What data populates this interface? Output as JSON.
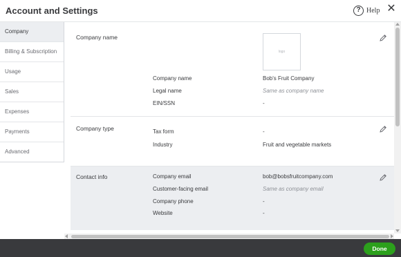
{
  "header": {
    "title": "Account and Settings",
    "help_label": "Help",
    "help_icon_glyph": "?",
    "close_glyph": "✕"
  },
  "sidebar": {
    "items": [
      {
        "label": "Company",
        "active": true
      },
      {
        "label": "Billing & Subscription"
      },
      {
        "label": "Usage"
      },
      {
        "label": "Sales"
      },
      {
        "label": "Expenses"
      },
      {
        "label": "Payments"
      },
      {
        "label": "Advanced"
      }
    ]
  },
  "sections": {
    "company_name": {
      "title": "Company name",
      "logo_placeholder": "logo",
      "rows": [
        {
          "label": "Company name",
          "value": "Bob's Fruit Company"
        },
        {
          "label": "Legal name",
          "value": "Same as company name"
        },
        {
          "label": "EIN/SSN",
          "value": "-"
        }
      ]
    },
    "company_type": {
      "title": "Company type",
      "rows": [
        {
          "label": "Tax form",
          "value": "-"
        },
        {
          "label": "Industry",
          "value": "Fruit and vegetable markets"
        }
      ]
    },
    "contact_info": {
      "title": "Contact info",
      "rows": [
        {
          "label": "Company email",
          "value": "bob@bobsfruitcompany.com"
        },
        {
          "label": "Customer-facing email",
          "value": "Same as company email"
        },
        {
          "label": "Company phone",
          "value": "-"
        },
        {
          "label": "Website",
          "value": "-"
        }
      ]
    }
  },
  "footer": {
    "done_label": "Done"
  },
  "colors": {
    "accent": "#2ca01c",
    "footer_bg": "#393a3d",
    "active_bg": "#eceef1"
  }
}
